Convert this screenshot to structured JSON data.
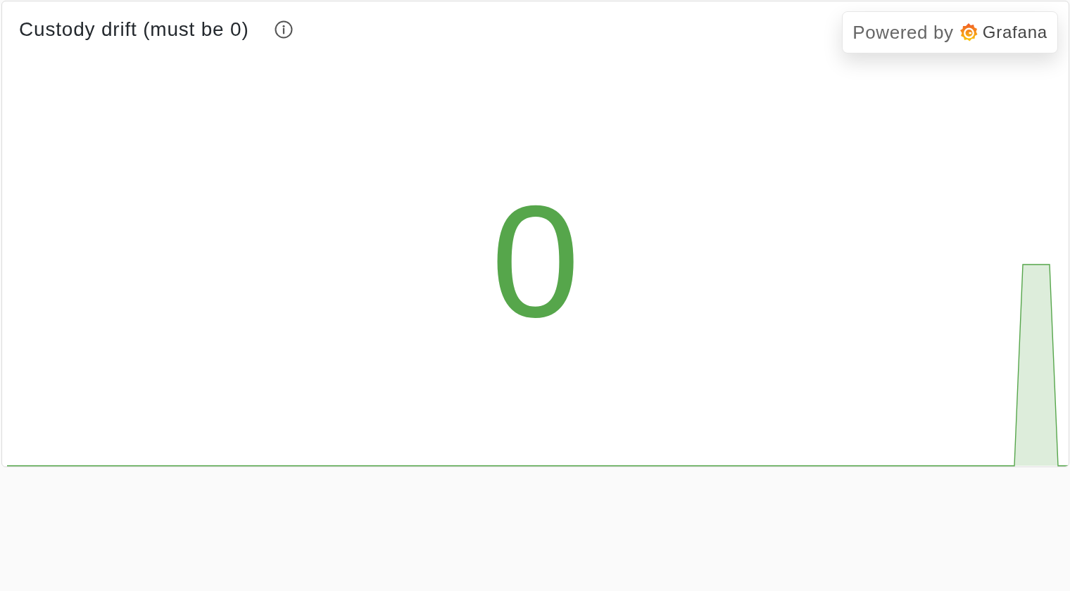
{
  "panel": {
    "title": "Custody drift (must be 0)"
  },
  "stat": {
    "value": "0"
  },
  "powered_by": {
    "label": "Powered by",
    "brand": "Grafana"
  }
}
